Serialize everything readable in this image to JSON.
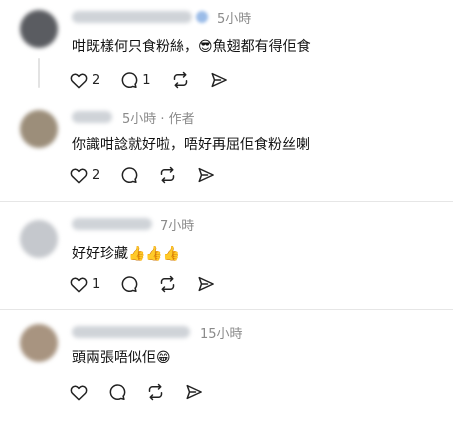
{
  "posts": [
    {
      "username": "",
      "time": "5小時",
      "author_tag": "",
      "text": "咁既樣何只食粉絲，😎魚翅都有得佢食",
      "likes": "2",
      "replies": "1",
      "avatar_color": "#5a5c61"
    },
    {
      "username": "",
      "time": "5小時",
      "author_tag": "· 作者",
      "text": "你識咁諗就好啦，唔好再屈佢食粉丝喇",
      "likes": "2",
      "replies": "",
      "avatar_color": "#9c8e7a"
    },
    {
      "username": "",
      "time": "7小時",
      "author_tag": "",
      "text": "好好珍藏👍👍👍",
      "likes": "1",
      "replies": "",
      "avatar_color": "#c5c8cd"
    },
    {
      "username": "",
      "time": "15小時",
      "author_tag": "",
      "text": "頭兩張唔似佢😁",
      "likes": "",
      "replies": "",
      "avatar_color": "#a89480"
    }
  ],
  "icons": {
    "like": "heart-icon",
    "reply": "comment-icon",
    "repost": "repost-icon",
    "share": "send-icon"
  },
  "colors": {
    "text": "#111111",
    "meta": "#8a8a8a",
    "divider": "#e6e6e6",
    "verified": "#9bbce8"
  }
}
